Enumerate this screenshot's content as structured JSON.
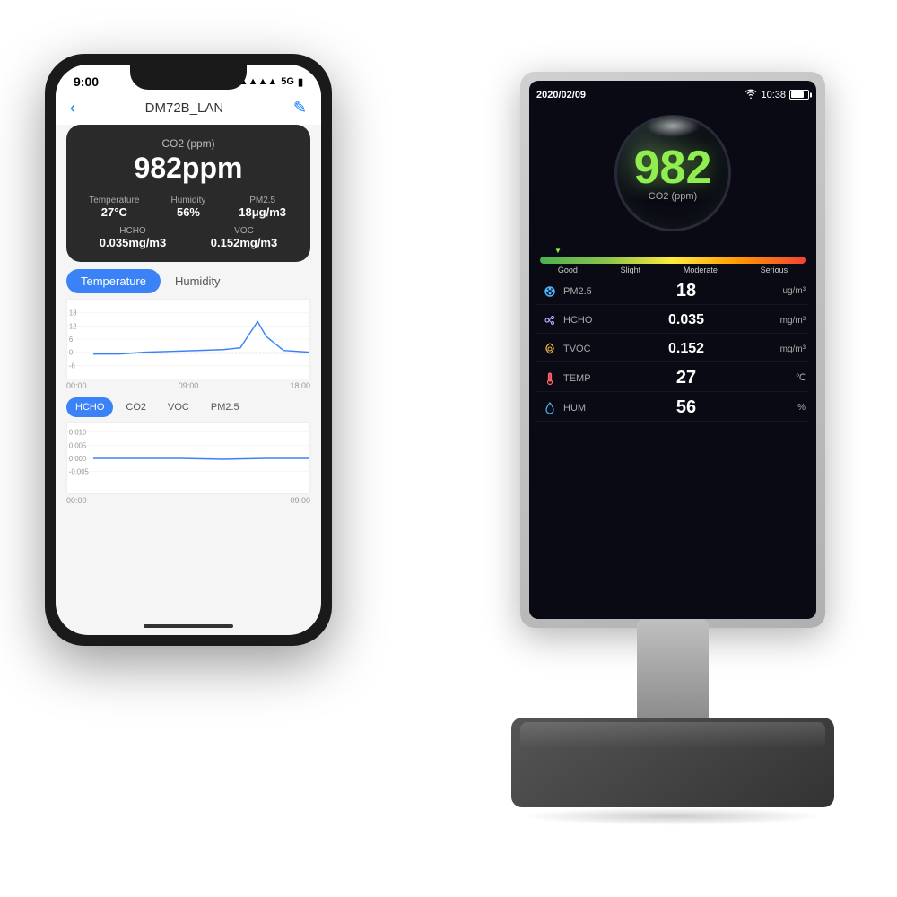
{
  "scene": {
    "background": "#ffffff"
  },
  "phone": {
    "status_bar": {
      "time": "9:00",
      "signal": "●●●●",
      "network": "5G",
      "battery": "🔋"
    },
    "header": {
      "back_label": "‹",
      "title": "DM72B_LAN",
      "edit_label": "✎"
    },
    "sensor_card": {
      "metric_label": "CO2",
      "value": "982ppm",
      "metrics": [
        {
          "label": "Temperature",
          "value": "27°C"
        },
        {
          "label": "Humidity",
          "value": "56%"
        },
        {
          "label": "PM2.5",
          "value": "18μg/m3"
        }
      ],
      "metrics2": [
        {
          "label": "HCHO",
          "value": "0.035mg/m3"
        },
        {
          "label": "VOC",
          "value": "0.152mg/m3"
        }
      ]
    },
    "tabs1": [
      {
        "label": "Temperature",
        "active": true
      },
      {
        "label": "Humidity",
        "active": false
      }
    ],
    "chart1": {
      "y_labels": [
        "18",
        "12",
        "6",
        "0",
        "-6"
      ],
      "x_labels": [
        "00:00",
        "09:00",
        "18:00"
      ]
    },
    "tabs2": [
      {
        "label": "HCHO",
        "active": true
      },
      {
        "label": "CO2",
        "active": false
      },
      {
        "label": "VOC",
        "active": false
      },
      {
        "label": "PM2.5",
        "active": false
      }
    ],
    "chart2": {
      "y_labels": [
        "0.010",
        "0.005",
        "0.000",
        "-0.005"
      ],
      "x_labels": [
        "00:00",
        "09:00"
      ]
    },
    "home_indicator": "—"
  },
  "device": {
    "status": {
      "date": "2020/02/09",
      "time": "10:38"
    },
    "co2": {
      "value": "982",
      "label": "CO2 (ppm)"
    },
    "color_bar": {
      "arrow_position": "left",
      "labels": [
        "Good",
        "Slight",
        "Moderate",
        "Serious"
      ]
    },
    "readings": [
      {
        "icon": "pm25-icon",
        "name": "PM2.5",
        "value": "18",
        "unit": "ug/m³"
      },
      {
        "icon": "hcho-icon",
        "name": "HCHO",
        "value": "0.035",
        "unit": "mg/m³"
      },
      {
        "icon": "tvoc-icon",
        "name": "TVOC",
        "value": "0.152",
        "unit": "mg/m³"
      },
      {
        "icon": "temp-icon",
        "name": "TEMP",
        "value": "27",
        "unit": "℃"
      },
      {
        "icon": "hum-icon",
        "name": "HUM",
        "value": "56",
        "unit": "%"
      }
    ]
  }
}
